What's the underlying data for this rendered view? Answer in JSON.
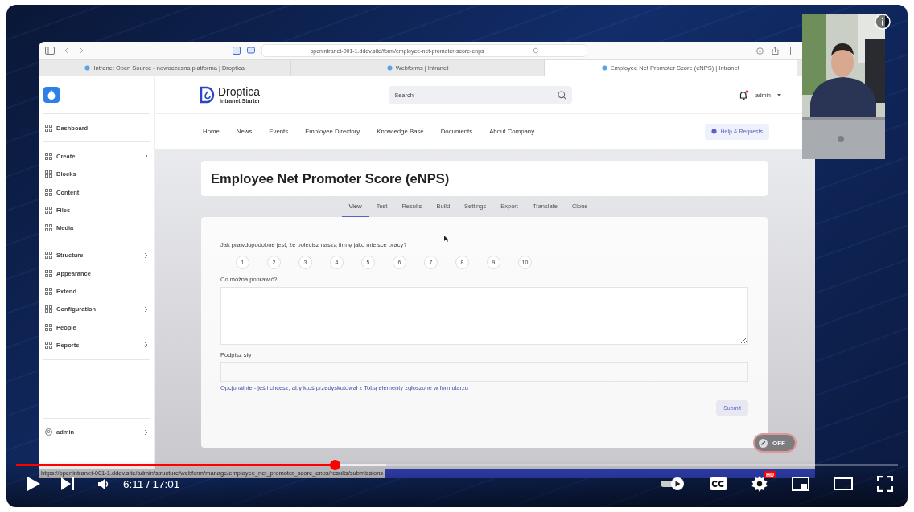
{
  "browser": {
    "address": "openintranet-001-1.ddev.site/form/employee-net-promoter-score-enps",
    "tabs": [
      {
        "title": "Intranet Open Source - nowoczesna platforma | Droptica",
        "selected": false
      },
      {
        "title": "Webforms | Intranet",
        "selected": false
      },
      {
        "title": "Employee Net Promoter Score (eNPS) | Intranet",
        "selected": true
      }
    ],
    "status_url": "https://openintranet-001-1.ddev.site/admin/structure/webform/manage/employee_net_promoter_score_enps/results/submissions"
  },
  "sidebar": {
    "groups": [
      [
        {
          "label": "Dashboard",
          "has_children": false
        }
      ],
      [
        {
          "label": "Create",
          "has_children": true
        },
        {
          "label": "Blocks",
          "has_children": false
        },
        {
          "label": "Content",
          "has_children": false
        },
        {
          "label": "Files",
          "has_children": false
        },
        {
          "label": "Media",
          "has_children": false
        }
      ],
      [
        {
          "label": "Structure",
          "has_children": true
        },
        {
          "label": "Appearance",
          "has_children": false
        },
        {
          "label": "Extend",
          "has_children": false
        },
        {
          "label": "Configuration",
          "has_children": true
        },
        {
          "label": "People",
          "has_children": false
        },
        {
          "label": "Reports",
          "has_children": true
        }
      ]
    ],
    "user": {
      "label": "admin",
      "has_children": true
    }
  },
  "header": {
    "logo": "Droptica",
    "tagline": "Intranet Starter",
    "search": {
      "placeholder": "Search"
    },
    "notification": true,
    "user": "admin"
  },
  "nav": {
    "items": [
      "Home",
      "News",
      "Events",
      "Employee Directory",
      "Knowledge Base",
      "Documents",
      "About Company"
    ],
    "help_button": "Help & Requests"
  },
  "page": {
    "title": "Employee Net Promoter Score (eNPS)",
    "tabs": [
      {
        "label": "View",
        "selected": true
      },
      {
        "label": "Test",
        "selected": false
      },
      {
        "label": "Results",
        "selected": false
      },
      {
        "label": "Build",
        "selected": false
      },
      {
        "label": "Settings",
        "selected": false
      },
      {
        "label": "Export",
        "selected": false
      },
      {
        "label": "Translate",
        "selected": false
      },
      {
        "label": "Clone",
        "selected": false
      }
    ],
    "form": {
      "question": "Jak prawdopodobne jest, że polecisz naszą firmę jako miejsce pracy?",
      "scale": [
        "1",
        "2",
        "3",
        "4",
        "5",
        "6",
        "7",
        "8",
        "9",
        "10"
      ],
      "comment_label": "Co można poprawić?",
      "signature_label": "Podpisz się",
      "signature_help": "Opcjonalnie - jeśli chcesz, aby ktoś przedyskutował z Tobą elementy zgłoszone w formularzu",
      "submit": "Submit"
    },
    "edit_toggle": {
      "label": "OFF",
      "on": false
    }
  },
  "player": {
    "progress": {
      "level": 0.362
    },
    "buffered": {
      "level": 0.42
    },
    "time": "6:11 / 17:01",
    "autoplay": {
      "on": true
    },
    "quality_badge": "HD"
  }
}
